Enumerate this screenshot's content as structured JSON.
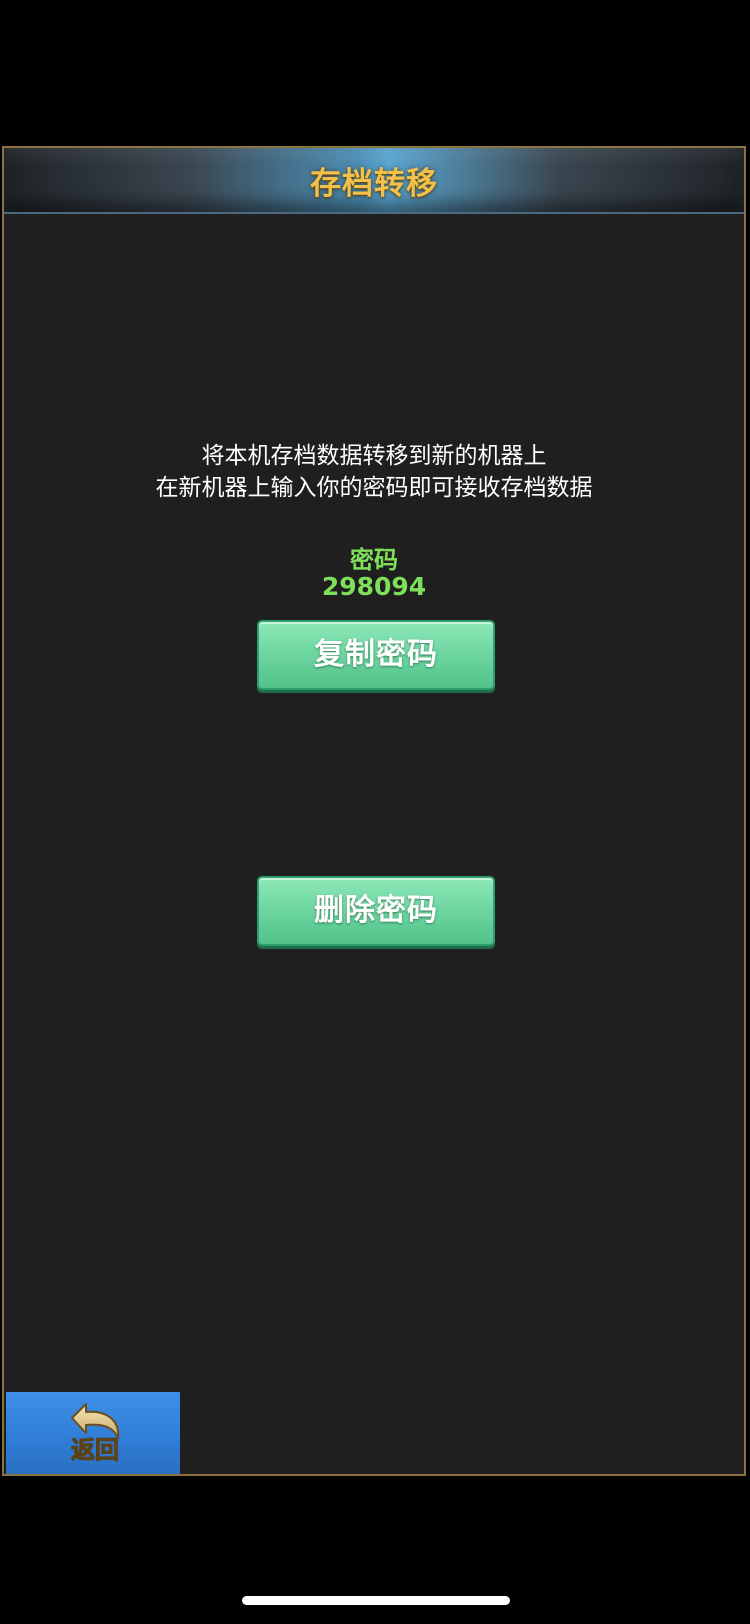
{
  "dialog": {
    "title": "存档转移",
    "description_line1": "将本机存档数据转移到新的机器上",
    "description_line2": "在新机器上输入你的密码即可接收存档数据",
    "password_label": "密码",
    "password_value": "298094",
    "copy_button_label": "复制密码",
    "delete_button_label": "删除密码"
  },
  "back_button": {
    "label": "返回",
    "icon": "back-arrow-icon"
  },
  "colors": {
    "panel_border": "#8a7340",
    "panel_bg": "#201f20",
    "title_text": "#f3c14a",
    "password_text": "#7ee05a",
    "button_green": "#6fd7a2",
    "back_button_blue": "#2f7dd5"
  }
}
